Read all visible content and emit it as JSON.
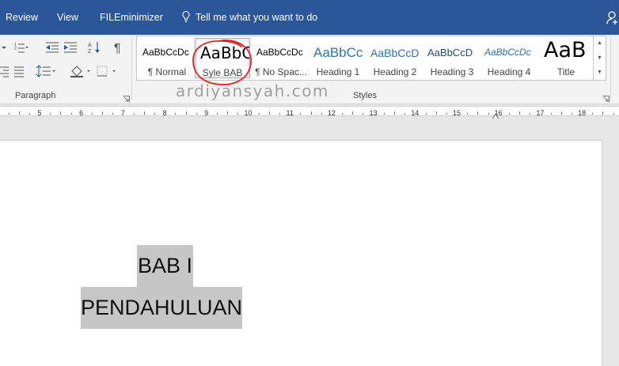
{
  "tabs": [
    {
      "label": "Review"
    },
    {
      "label": "View"
    },
    {
      "label": "FILEminimizer"
    }
  ],
  "tell_me": {
    "placeholder": "Tell me what you want to do",
    "icon": "lightbulb-icon"
  },
  "ribbon": {
    "paragraph_group": {
      "label": "Paragraph"
    },
    "styles_group": {
      "label": "Styles",
      "styles": [
        {
          "preview": "AaBbCcDc",
          "name": "¶ Normal"
        },
        {
          "preview": "AaBbC",
          "name": "Syle BAB",
          "selected": true
        },
        {
          "preview": "AaBbCcDc",
          "name": "¶ No Spac..."
        },
        {
          "preview": "AaBbCc",
          "name": "Heading 1"
        },
        {
          "preview": "AaBbCcD",
          "name": "Heading 2"
        },
        {
          "preview": "AaBbCcD",
          "name": "Heading 3"
        },
        {
          "preview": "AaBbCcDc",
          "name": "Heading 4"
        },
        {
          "preview": "AaB",
          "name": "Title"
        }
      ]
    }
  },
  "watermark": "ardiyansyah.com",
  "ruler": {
    "numbers": [
      "5",
      "6",
      "7",
      "8",
      "9",
      "10",
      "11",
      "12",
      "13",
      "14",
      "15",
      "16",
      "17",
      "18"
    ]
  },
  "document": {
    "lines": [
      "BAB I",
      "PENDAHULUAN"
    ]
  },
  "colors": {
    "accent": "#2b579a",
    "heading_blue": "#2e74b5",
    "annotation": "#e8202a",
    "selection": "#c6c6c6"
  }
}
